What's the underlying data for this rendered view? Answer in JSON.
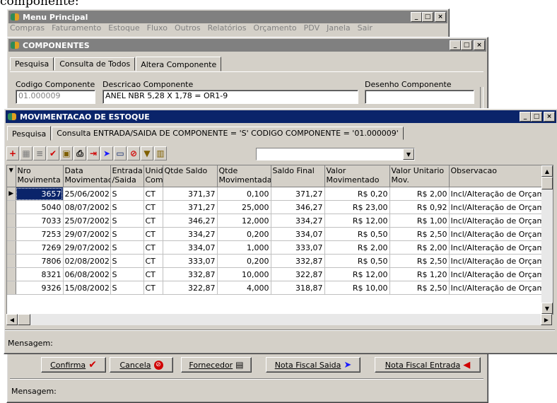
{
  "page_header": "componente:",
  "colors": {
    "active_title": "#0a246a",
    "inactive_title": "#808080",
    "face": "#d4d0c8",
    "check": "#d00000",
    "arrow_blue": "#1a1aff"
  },
  "menu_principal": {
    "title": "Menu Principal",
    "menu": [
      "Compras",
      "Faturamento",
      "Estoque",
      "Fluxo",
      "Outros",
      "Relatórios",
      "Orçamento",
      "PDV",
      "Janela",
      "Sair"
    ]
  },
  "componentes": {
    "title": "COMPONENTES",
    "tabs": [
      "Pesquisa",
      "Consulta de Todos",
      "Altera Componente"
    ],
    "codigo_label": "Codigo Componente",
    "codigo_value": "01.000009",
    "descricao_label": "Descricao Componente",
    "descricao_value": "ANEL NBR 5,28 X 1,78 = OR1-9",
    "desenho_label": "Desenho Componente",
    "mensagem_label": "Mensagem:",
    "buttons": {
      "confirma": "Confirma",
      "cancela": "Cancela",
      "fornecedor": "Fornecedor",
      "nf_saida": "Nota Fiscal Saida",
      "nf_entrada": "Nota Fiscal Entrada"
    }
  },
  "movimentacao": {
    "title": "MOVIMENTACAO DE ESTOQUE",
    "tabs": [
      "Pesquisa",
      "Consulta  ENTRADA/SAIDA DE COMPONENTE = 'S'  CODIGO COMPONENTE = '01.000009'"
    ],
    "columns": [
      "Nro Movimenta",
      "Data Movimentac",
      "Entrada /Saida",
      "Unid Com",
      "Qtde Saldo",
      "Qtde Movimentada",
      "Saldo Final",
      "Valor Movimentado",
      "Valor Unitario Mov.",
      "Observacao"
    ],
    "rows": [
      [
        "3657",
        "25/06/2002",
        "S",
        "CT",
        "371,37",
        "0,100",
        "371,27",
        "R$ 0,20",
        "R$ 2,00",
        "Incl/Alteração de Orçam"
      ],
      [
        "5040",
        "08/07/2002",
        "S",
        "CT",
        "371,27",
        "25,000",
        "346,27",
        "R$ 23,00",
        "R$ 0,92",
        "Incl/Alteração de Orçam"
      ],
      [
        "7033",
        "25/07/2002",
        "S",
        "CT",
        "346,27",
        "12,000",
        "334,27",
        "R$ 12,00",
        "R$ 1,00",
        "Incl/Alteração de Orçam"
      ],
      [
        "7253",
        "29/07/2002",
        "S",
        "CT",
        "334,27",
        "0,200",
        "334,07",
        "R$ 0,50",
        "R$ 2,50",
        "Incl/Alteração de Orçam"
      ],
      [
        "7269",
        "29/07/2002",
        "S",
        "CT",
        "334,07",
        "1,000",
        "333,07",
        "R$ 2,00",
        "R$ 2,00",
        "Incl/Alteração de Orçam"
      ],
      [
        "7806",
        "02/08/2002",
        "S",
        "CT",
        "333,07",
        "0,200",
        "332,87",
        "R$ 0,50",
        "R$ 2,50",
        "Incl/Alteração de Orçam"
      ],
      [
        "8321",
        "06/08/2002",
        "S",
        "CT",
        "332,87",
        "10,000",
        "322,87",
        "R$ 12,00",
        "R$ 1,20",
        "Incl/Alteração de Orçam"
      ],
      [
        "9326",
        "15/08/2002",
        "S",
        "CT",
        "322,87",
        "4,000",
        "318,87",
        "R$ 10,00",
        "R$ 2,50",
        "Incl/Alteração de Orçam"
      ]
    ],
    "mensagem_label": "Mensagem:",
    "combo_value": ""
  }
}
